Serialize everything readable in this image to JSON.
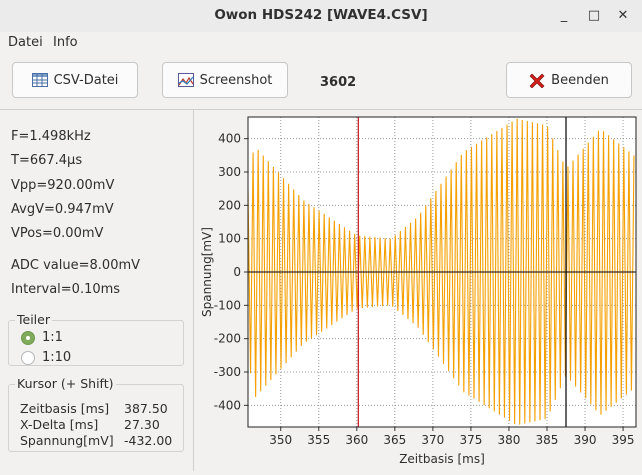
{
  "window": {
    "title": "Owon HDS242 [WAVE4.CSV]",
    "minimize": "_",
    "maximize": "□",
    "close": "✕"
  },
  "menu": {
    "items": [
      "Datei",
      "Info"
    ]
  },
  "toolbar": {
    "csv_label": "CSV-Datei",
    "screenshot_label": "Screenshot",
    "counter": "3602",
    "quit_label": "Beenden"
  },
  "measurements": {
    "freq": "F=1.498kHz",
    "period": "T=667.4µs",
    "vpp": "Vpp=920.00mV",
    "avg": "AvgV=0.947mV",
    "vpos": "VPos=0.00mV",
    "adc": "ADC value=8.00mV",
    "interval": "Interval=0.10ms"
  },
  "teiler": {
    "label": "Teiler",
    "options": [
      "1:1",
      "1:10"
    ],
    "selected": "1:1"
  },
  "cursor": {
    "label": "Kursor (+ Shift)",
    "rows": [
      {
        "name": "Zeitbasis [ms]",
        "value": "387.50"
      },
      {
        "name": "X-Delta [ms]",
        "value": "27.30"
      },
      {
        "name": "Spannung[mV]",
        "value": "-432.00"
      }
    ]
  },
  "chart_data": {
    "type": "line",
    "xlabel": "Zeitbasis [ms]",
    "ylabel": "Spannung[mV]",
    "xlim": [
      345.7,
      396.7
    ],
    "ylim": [
      -465,
      465
    ],
    "xticks": [
      350,
      355,
      360,
      365,
      370,
      375,
      380,
      385,
      390,
      395
    ],
    "yticks": [
      400,
      300,
      200,
      100,
      0,
      -100,
      -200,
      -300,
      -400
    ],
    "grid": true,
    "signal": {
      "frequency_khz": 1.498,
      "envelope_ms": [
        345.7,
        346.5,
        353,
        360,
        364.5,
        368,
        374,
        381,
        385,
        387.5,
        392,
        396.7
      ],
      "envelope_mv": [
        250,
        380,
        215,
        110,
        100,
        165,
        360,
        460,
        440,
        310,
        430,
        345
      ]
    },
    "cursors": [
      {
        "x": 360.2,
        "color": "#cc1111"
      },
      {
        "x": 387.5,
        "color": "#000000"
      }
    ],
    "colors": {
      "trace": "#f5a000",
      "zero": "#000000",
      "background": "#ffffff"
    }
  }
}
